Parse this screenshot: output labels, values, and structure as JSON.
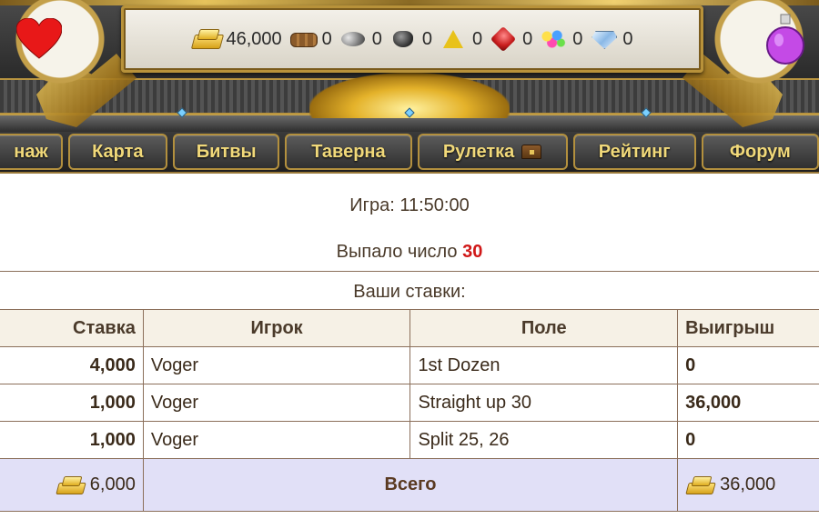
{
  "resources": [
    {
      "icon": "gold-icon",
      "value": "46,000"
    },
    {
      "icon": "wood-icon",
      "value": "0"
    },
    {
      "icon": "ore-icon",
      "value": "0"
    },
    {
      "icon": "mercury-icon",
      "value": "0"
    },
    {
      "icon": "sulfur-icon",
      "value": "0"
    },
    {
      "icon": "crystal-icon",
      "value": "0"
    },
    {
      "icon": "gems-icon",
      "value": "0"
    },
    {
      "icon": "diamond-icon",
      "value": "0"
    }
  ],
  "nav": {
    "tabs": [
      {
        "label": "нaж"
      },
      {
        "label": "Карта"
      },
      {
        "label": "Битвы"
      },
      {
        "label": "Таверна"
      },
      {
        "label": "Рулетка"
      },
      {
        "label": "Рейтинг"
      },
      {
        "label": "Форум"
      }
    ]
  },
  "game": {
    "time_label": "Игра: 11:50:00",
    "drawn_prefix": "Выпало число",
    "drawn_number": "30",
    "drawn_number_color": "#d01818",
    "bets_title": "Ваши ставки:"
  },
  "table": {
    "headers": {
      "bet": "Ставка",
      "player": "Игрок",
      "field": "Поле",
      "win": "Выигрыш"
    },
    "rows": [
      {
        "bet": "4,000",
        "player": "Voger",
        "field": "1st Dozen",
        "win": "0"
      },
      {
        "bet": "1,000",
        "player": "Voger",
        "field": "Straight up 30",
        "win": "36,000"
      },
      {
        "bet": "1,000",
        "player": "Voger",
        "field": "Split 25, 26",
        "win": "0"
      }
    ],
    "total": {
      "bet": "6,000",
      "label": "Всего",
      "win": "36,000"
    }
  },
  "colors": {
    "nav_text": "#f1d97a",
    "total_row_bg": "#e1e0f7",
    "header_bg": "#f6f1e6"
  }
}
